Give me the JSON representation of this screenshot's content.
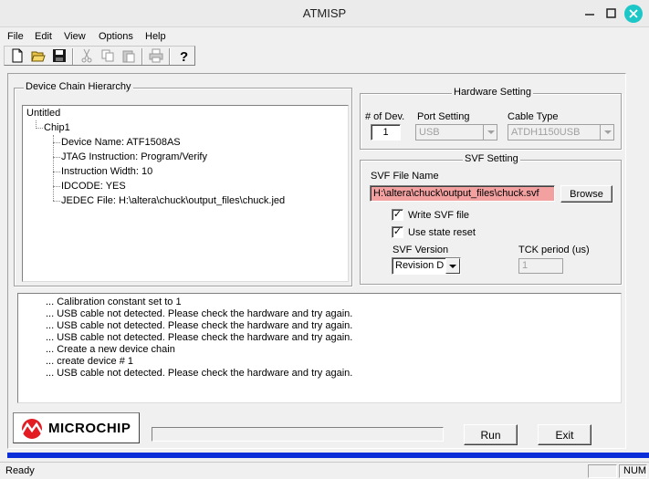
{
  "window": {
    "title": "ATMISP"
  },
  "menu": [
    "File",
    "Edit",
    "View",
    "Options",
    "Help"
  ],
  "chain": {
    "group_label": "Device Chain Hierarchy",
    "root": "Untitled",
    "chip": "Chip1",
    "details": [
      "Device Name: ATF1508AS",
      "JTAG Instruction: Program/Verify",
      "Instruction Width: 10",
      "IDCODE: YES",
      "JEDEC File: H:\\altera\\chuck\\output_files\\chuck.jed"
    ]
  },
  "hardware": {
    "group_label": "Hardware Setting",
    "num_dev_label": "# of Dev.",
    "num_dev_value": "1",
    "port_label": "Port Setting",
    "port_value": "USB",
    "cable_label": "Cable Type",
    "cable_value": "ATDH1150USB"
  },
  "svf": {
    "group_label": "SVF Setting",
    "file_label": "SVF File Name",
    "file_value": "H:\\altera\\chuck\\output_files\\chuck.svf",
    "browse_label": "Browse",
    "write_svf_label": "Write SVF file",
    "write_svf_checked": true,
    "state_reset_label": "Use state reset",
    "state_reset_checked": true,
    "version_label": "SVF Version",
    "version_value": "Revision D",
    "tck_label": "TCK period (us)",
    "tck_value": "1"
  },
  "log": [
    "...  Calibration constant set to 1",
    "...  USB cable not detected. Please check the hardware and try again.",
    "...  USB cable not detected. Please check the hardware and try again.",
    "...  USB cable not detected. Please check the hardware and try again.",
    "...  Create a new device chain",
    "...  create device # 1",
    "...  USB cable not detected. Please check the hardware and try again."
  ],
  "footer": {
    "logo_text": "MICROCHIP",
    "run_label": "Run",
    "exit_label": "Exit",
    "progress": 0
  },
  "statusbar": {
    "text": "Ready",
    "num": "NUM"
  },
  "colors": {
    "svf_field_bg": "#f2a0a0",
    "bluebar": "#0a2fd8",
    "close_btn": "#1ec7c7"
  },
  "icons": [
    "new-file-icon",
    "open-folder-icon",
    "save-icon",
    "cut-icon",
    "copy-icon",
    "paste-icon",
    "print-icon",
    "help-icon"
  ]
}
